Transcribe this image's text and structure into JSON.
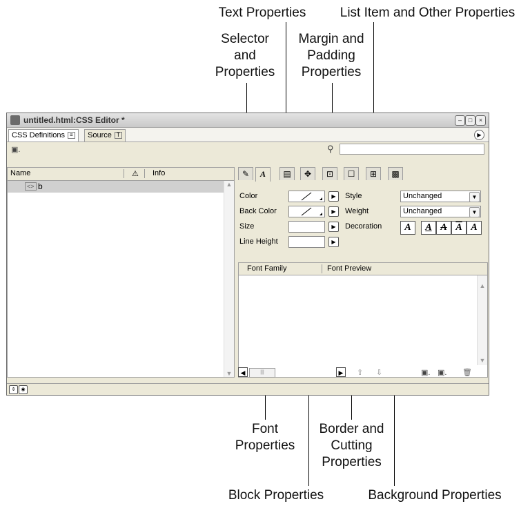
{
  "callouts": {
    "text_properties": "Text Properties",
    "list_item": "List Item and Other Properties",
    "selector_1": "Selector",
    "selector_2": "and",
    "selector_3": "Properties",
    "margin_1": "Margin and",
    "margin_2": "Padding",
    "margin_3": "Properties",
    "font_1": "Font",
    "font_2": "Properties",
    "border_1": "Border and",
    "border_2": "Cutting",
    "border_3": "Properties",
    "block": "Block Properties",
    "background": "Background Properties"
  },
  "window": {
    "title": "untitled.html:CSS Editor *",
    "tabs": [
      "CSS Definitions",
      "Source"
    ]
  },
  "list": {
    "col_name": "Name",
    "col_info": "Info",
    "rows": [
      {
        "name": "b"
      }
    ]
  },
  "form": {
    "color_label": "Color",
    "back_color_label": "Back Color",
    "size_label": "Size",
    "line_height_label": "Line Height",
    "style_label": "Style",
    "weight_label": "Weight",
    "decoration_label": "Decoration",
    "style_value": "Unchanged",
    "weight_value": "Unchanged"
  },
  "fontlist": {
    "col_family": "Font Family",
    "col_preview": "Font Preview"
  },
  "category_tabs": [
    "selector",
    "font",
    "text",
    "block",
    "margin-padding",
    "border",
    "list-item",
    "background"
  ]
}
